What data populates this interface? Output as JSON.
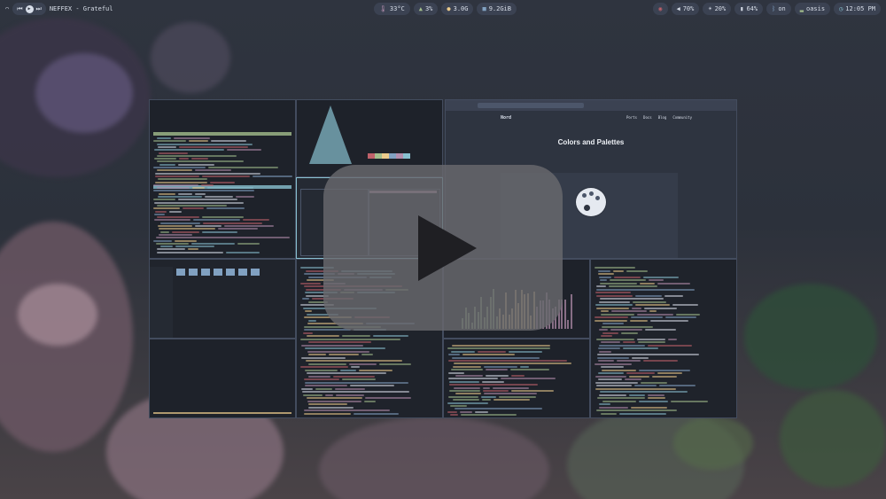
{
  "topbar": {
    "left": {
      "wifi_icon": "wifi-icon",
      "track": "NEFFEX - Grateful"
    },
    "center": [
      {
        "icon": "thermometer-icon",
        "label": "33°C",
        "color": "#b48ead"
      },
      {
        "icon": "cpu-chart-icon",
        "label": "3%",
        "color": "#a3be8c"
      },
      {
        "icon": "memory-icon",
        "label": "3.0G",
        "color": "#ebcb8b"
      },
      {
        "icon": "folder-icon",
        "label": "9.2GiB",
        "color": "#81a1c1"
      }
    ],
    "right": [
      {
        "icon": "eye-icon",
        "label": "",
        "color": "#bf616a"
      },
      {
        "icon": "volume-icon",
        "label": "70%",
        "color": "#d8dee9"
      },
      {
        "icon": "brightness-icon",
        "label": "20%",
        "color": "#d8dee9"
      },
      {
        "icon": "battery-icon",
        "label": "64%",
        "color": "#d8dee9"
      },
      {
        "icon": "bluetooth-icon",
        "label": "on",
        "color": "#81a1c1"
      },
      {
        "icon": "signal-icon",
        "label": "oasis",
        "color": "#a3be8c"
      },
      {
        "icon": "clock-icon",
        "label": "12:05 PM",
        "color": "#88c0d0"
      }
    ]
  },
  "browser": {
    "site": "Nord",
    "nav": [
      "Ports",
      "Docs",
      "Blog",
      "Community"
    ],
    "heading": "Colors and Palettes"
  },
  "colors": {
    "accent": "#88c0d0",
    "green": "#a3be8c",
    "red": "#bf616a",
    "yellow": "#ebcb8b",
    "purple": "#b48ead",
    "blue": "#81a1c1"
  }
}
